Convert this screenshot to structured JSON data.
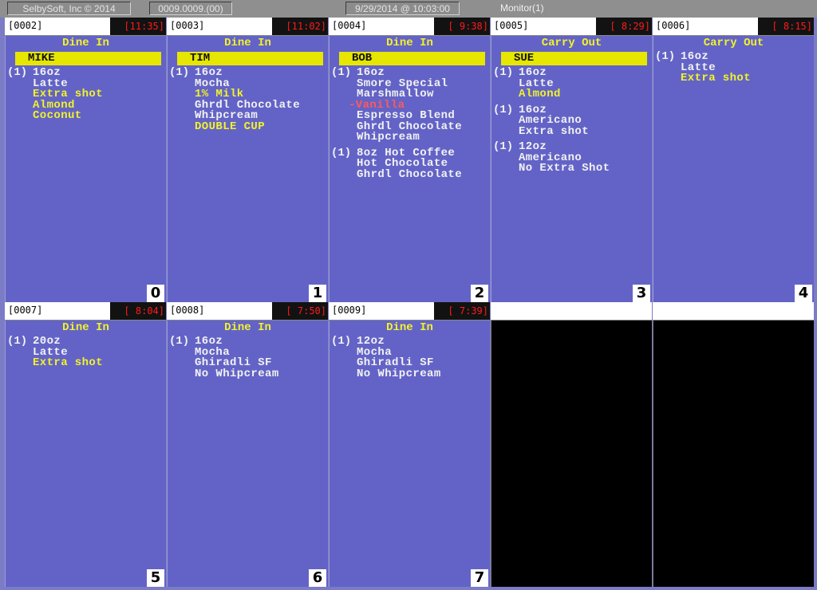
{
  "topbar": {
    "company": "SelbySoft, Inc   © 2014",
    "counter": "0009.0009.(00)",
    "datetime": "9/29/2014 @ 10:03:00",
    "monitor": "Monitor(1)"
  },
  "colors": {
    "panel_bg": "#6363c7",
    "header_bg": "#ffffff",
    "timer_bg": "#121212",
    "timer_text": "#ff1a1a",
    "order_type_text": "#f2f22a",
    "customer_bar": "#e6e600",
    "modifier_text": "#f2f22a",
    "removed_text": "#ff5a5a",
    "empty_panel": "#000000"
  },
  "orders": [
    {
      "slot": "0",
      "number": "[0002]",
      "timer": "[11:35]",
      "type": "Dine In",
      "customer": "MIKE",
      "items": [
        {
          "qty": "(1)",
          "lines": [
            {
              "text": "16oz",
              "kind": "base"
            },
            {
              "text": "Latte",
              "kind": "base"
            },
            {
              "text": "Extra shot",
              "kind": "mod"
            },
            {
              "text": "Almond",
              "kind": "mod"
            },
            {
              "text": "Coconut",
              "kind": "mod"
            }
          ]
        }
      ]
    },
    {
      "slot": "1",
      "number": "[0003]",
      "timer": "[11:02]",
      "type": "Dine In",
      "customer": "TIM",
      "items": [
        {
          "qty": "(1)",
          "lines": [
            {
              "text": "16oz",
              "kind": "base"
            },
            {
              "text": "Mocha",
              "kind": "base"
            },
            {
              "text": "1% Milk",
              "kind": "mod"
            },
            {
              "text": "Ghrdl Chocolate",
              "kind": "base"
            },
            {
              "text": "Whipcream",
              "kind": "base"
            },
            {
              "text": "DOUBLE CUP",
              "kind": "mod"
            }
          ]
        }
      ]
    },
    {
      "slot": "2",
      "number": "[0004]",
      "timer": "[ 9:38]",
      "type": "Dine In",
      "customer": "BOB",
      "items": [
        {
          "qty": "(1)",
          "lines": [
            {
              "text": "16oz",
              "kind": "base"
            },
            {
              "text": "Smore Special",
              "kind": "base"
            },
            {
              "text": "Marshmallow",
              "kind": "base"
            },
            {
              "text": "-Vanilla",
              "kind": "removed"
            },
            {
              "text": "Espresso Blend",
              "kind": "base"
            },
            {
              "text": "Ghrdl Chocolate",
              "kind": "base"
            },
            {
              "text": "Whipcream",
              "kind": "base"
            }
          ]
        },
        {
          "qty": "(1)",
          "lines": [
            {
              "text": "8oz Hot Coffee",
              "kind": "base"
            },
            {
              "text": "Hot Chocolate",
              "kind": "base"
            },
            {
              "text": "Ghrdl Chocolate",
              "kind": "base"
            }
          ]
        }
      ]
    },
    {
      "slot": "3",
      "number": "[0005]",
      "timer": "[ 8:29]",
      "type": "Carry Out",
      "customer": "SUE",
      "items": [
        {
          "qty": "(1)",
          "lines": [
            {
              "text": "16oz",
              "kind": "base"
            },
            {
              "text": "Latte",
              "kind": "base"
            },
            {
              "text": "Almond",
              "kind": "mod"
            }
          ]
        },
        {
          "qty": "(1)",
          "lines": [
            {
              "text": "16oz",
              "kind": "base"
            },
            {
              "text": "Americano",
              "kind": "base"
            },
            {
              "text": "Extra shot",
              "kind": "base"
            }
          ]
        },
        {
          "qty": "(1)",
          "lines": [
            {
              "text": "12oz",
              "kind": "base"
            },
            {
              "text": "Americano",
              "kind": "base"
            },
            {
              "text": "No Extra Shot",
              "kind": "base"
            }
          ]
        }
      ]
    },
    {
      "slot": "4",
      "number": "[0006]",
      "timer": "[ 8:15]",
      "type": "Carry Out",
      "customer": "",
      "items": [
        {
          "qty": "(1)",
          "lines": [
            {
              "text": "16oz",
              "kind": "base"
            },
            {
              "text": "Latte",
              "kind": "base"
            },
            {
              "text": "Extra shot",
              "kind": "mod"
            }
          ]
        }
      ]
    },
    {
      "slot": "5",
      "number": "[0007]",
      "timer": "[ 8:04]",
      "type": "Dine In",
      "customer": "",
      "items": [
        {
          "qty": "(1)",
          "lines": [
            {
              "text": "20oz",
              "kind": "base"
            },
            {
              "text": "Latte",
              "kind": "base"
            },
            {
              "text": "Extra shot",
              "kind": "mod"
            }
          ]
        }
      ]
    },
    {
      "slot": "6",
      "number": "[0008]",
      "timer": "[ 7:50]",
      "type": "Dine In",
      "customer": "",
      "items": [
        {
          "qty": "(1)",
          "lines": [
            {
              "text": "16oz",
              "kind": "base"
            },
            {
              "text": "Mocha",
              "kind": "base"
            },
            {
              "text": "Ghiradli SF",
              "kind": "base"
            },
            {
              "text": "No Whipcream",
              "kind": "base"
            }
          ]
        }
      ]
    },
    {
      "slot": "7",
      "number": "[0009]",
      "timer": "[ 7:39]",
      "type": "Dine In",
      "customer": "",
      "items": [
        {
          "qty": "(1)",
          "lines": [
            {
              "text": "12oz",
              "kind": "base"
            },
            {
              "text": "Mocha",
              "kind": "base"
            },
            {
              "text": "Ghiradli SF",
              "kind": "base"
            },
            {
              "text": "No Whipcream",
              "kind": "base"
            }
          ]
        }
      ]
    },
    {
      "slot": "",
      "number": "",
      "timer": "",
      "type": "",
      "customer": "",
      "items": [],
      "empty": true
    },
    {
      "slot": "",
      "number": "",
      "timer": "",
      "type": "",
      "customer": "",
      "items": [],
      "empty": true
    }
  ]
}
